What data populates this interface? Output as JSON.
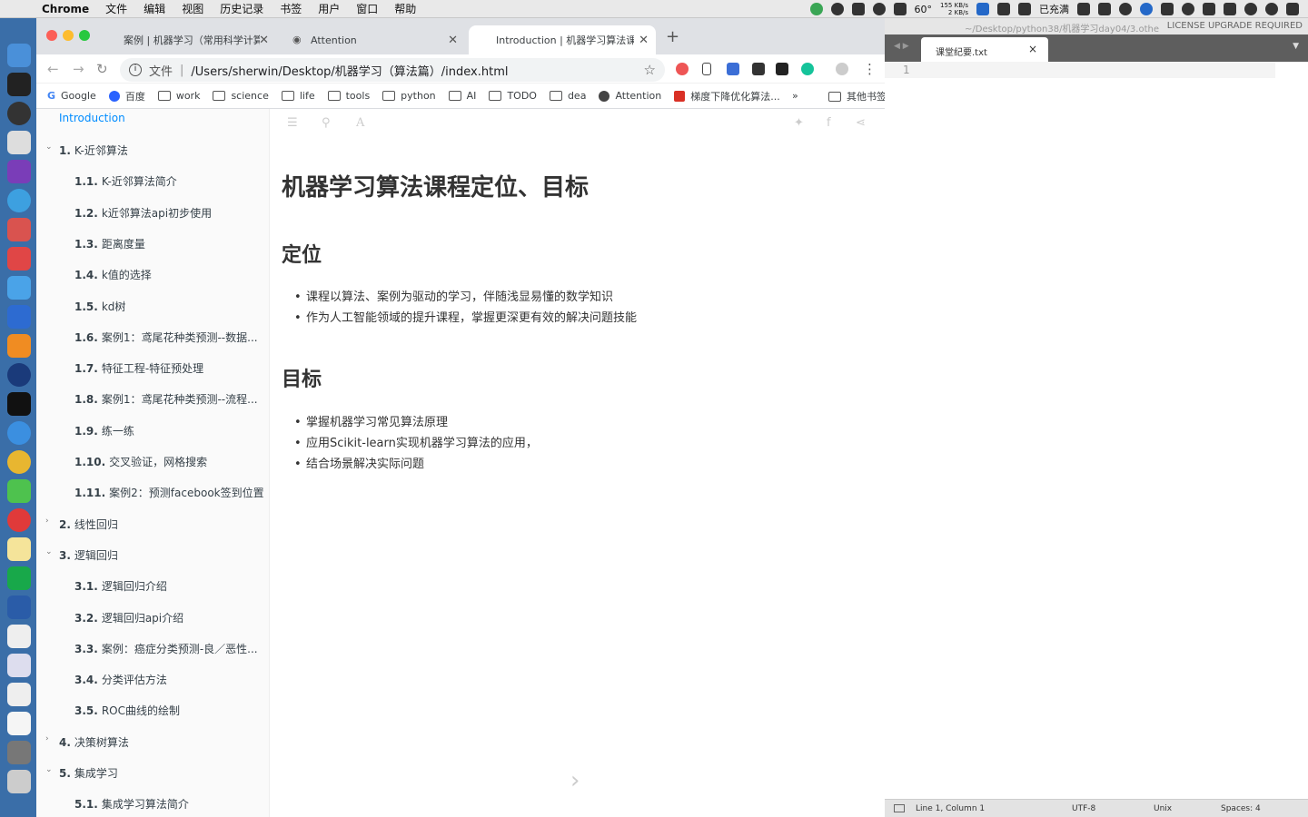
{
  "menubar": {
    "app": "Chrome",
    "items": [
      "文件",
      "编辑",
      "视图",
      "历史记录",
      "书签",
      "用户",
      "窗口",
      "帮助"
    ],
    "right": {
      "temp": "60°",
      "net_up": "155 KB/s",
      "net_down": "2 KB/s",
      "battery": "已充满"
    }
  },
  "tabs": [
    {
      "title": "案例 | 机器学习（常用科学计算",
      "icon": "book-icon",
      "active": false
    },
    {
      "title": "Attention",
      "icon": "globe-icon",
      "active": false
    },
    {
      "title": "Introduction | 机器学习算法课",
      "icon": "book-icon",
      "active": true
    }
  ],
  "omnibox": {
    "scheme": "文件",
    "url": "/Users/sherwin/Desktop/机器学习（算法篇）/index.html"
  },
  "bookmarks": [
    {
      "label": "Google",
      "icon": "google-icon"
    },
    {
      "label": "百度",
      "icon": "baidu-icon"
    },
    {
      "label": "work",
      "icon": "folder-icon"
    },
    {
      "label": "science",
      "icon": "folder-icon"
    },
    {
      "label": "life",
      "icon": "folder-icon"
    },
    {
      "label": "tools",
      "icon": "folder-icon"
    },
    {
      "label": "python",
      "icon": "folder-icon"
    },
    {
      "label": "AI",
      "icon": "folder-icon"
    },
    {
      "label": "TODO",
      "icon": "folder-icon"
    },
    {
      "label": "dea",
      "icon": "folder-icon"
    },
    {
      "label": "Attention",
      "icon": "globe-icon"
    },
    {
      "label": "梯度下降优化算法...",
      "icon": "csdn-icon"
    }
  ],
  "bookmarks_more": "»",
  "bookmarks_other": "其他书签",
  "sidebar": {
    "intro": "Introduction",
    "items": [
      {
        "num": "1.",
        "label": "K-近邻算法",
        "level": 1,
        "expanded": true
      },
      {
        "num": "1.1.",
        "label": "K-近邻算法简介",
        "level": 2
      },
      {
        "num": "1.2.",
        "label": "k近邻算法api初步使用",
        "level": 2
      },
      {
        "num": "1.3.",
        "label": "距离度量",
        "level": 2
      },
      {
        "num": "1.4.",
        "label": "k值的选择",
        "level": 2
      },
      {
        "num": "1.5.",
        "label": "kd树",
        "level": 2
      },
      {
        "num": "1.6.",
        "label": "案例1：鸢尾花种类预测--数据...",
        "level": 2
      },
      {
        "num": "1.7.",
        "label": "特征工程-特征预处理",
        "level": 2
      },
      {
        "num": "1.8.",
        "label": "案例1：鸢尾花种类预测--流程...",
        "level": 2
      },
      {
        "num": "1.9.",
        "label": "练一练",
        "level": 2
      },
      {
        "num": "1.10.",
        "label": "交叉验证，网格搜索",
        "level": 2
      },
      {
        "num": "1.11.",
        "label": "案例2：预测facebook签到位置",
        "level": 2
      },
      {
        "num": "2.",
        "label": "线性回归",
        "level": 1,
        "expanded": false
      },
      {
        "num": "3.",
        "label": "逻辑回归",
        "level": 1,
        "expanded": true
      },
      {
        "num": "3.1.",
        "label": "逻辑回归介绍",
        "level": 2
      },
      {
        "num": "3.2.",
        "label": "逻辑回归api介绍",
        "level": 2
      },
      {
        "num": "3.3.",
        "label": "案例：癌症分类预测-良／恶性...",
        "level": 2
      },
      {
        "num": "3.4.",
        "label": "分类评估方法",
        "level": 2
      },
      {
        "num": "3.5.",
        "label": "ROC曲线的绘制",
        "level": 2
      },
      {
        "num": "4.",
        "label": "决策树算法",
        "level": 1,
        "expanded": false
      },
      {
        "num": "5.",
        "label": "集成学习",
        "level": 1,
        "expanded": true
      },
      {
        "num": "5.1.",
        "label": "集成学习算法简介",
        "level": 2
      }
    ]
  },
  "article": {
    "title": "机器学习算法课程定位、目标",
    "sections": [
      {
        "heading": "定位",
        "bullets": [
          "课程以算法、案例为驱动的学习，伴随浅显易懂的数学知识",
          "作为人工智能领域的提升课程，掌握更深更有效的解决问题技能"
        ]
      },
      {
        "heading": "目标",
        "bullets": [
          "掌握机器学习常见算法原理",
          "应用Scikit-learn实现机器学习算法的应用，",
          "结合场景解决实际问题"
        ]
      }
    ]
  },
  "sublime": {
    "path": "~/Desktop/python38/机器学习day04/3.othe",
    "license": "LICENSE UPGRADE REQUIRED",
    "tab": "课堂纪要.txt",
    "line_number": "1",
    "status": {
      "position": "Line 1, Column 1",
      "encoding": "UTF-8",
      "line_endings": "Unix",
      "indent": "Spaces: 4"
    }
  }
}
